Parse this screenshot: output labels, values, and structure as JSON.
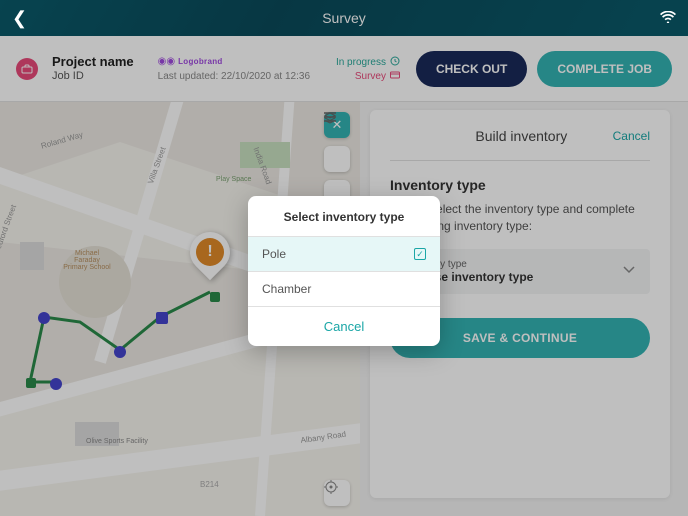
{
  "header": {
    "title": "Survey"
  },
  "job": {
    "project_name": "Project name",
    "job_id": "Job ID",
    "brand_label": "Logobrand",
    "last_updated": "Last updated: 22/10/2020 at 12:36",
    "status_progress": "In progress",
    "status_survey": "Survey"
  },
  "actions": {
    "check_out": "CHECK OUT",
    "complete_job": "COMPLETE JOB"
  },
  "panel": {
    "title": "Build inventory",
    "cancel": "Cancel",
    "section_heading": "Inventory type",
    "section_desc": "Please select the inventory type and complete the missing inventory type:",
    "dropdown_label": "Inventory type",
    "dropdown_value": "Choose inventory type",
    "save": "SAVE & CONTINUE"
  },
  "modal": {
    "title": "Select inventory type",
    "options": [
      {
        "label": "Pole",
        "selected": true
      },
      {
        "label": "Chamber",
        "selected": false
      }
    ],
    "cancel": "Cancel"
  },
  "map": {
    "labels": {
      "roland": "Roland Way",
      "india": "India Road",
      "villa": "Villa Street",
      "bedford": "Bedford Street",
      "albany": "Albany Road",
      "playspace": "Play Space",
      "school": "Michael Faraday Primary School",
      "sports": "Olive Sports Facility",
      "b214": "B214"
    }
  }
}
